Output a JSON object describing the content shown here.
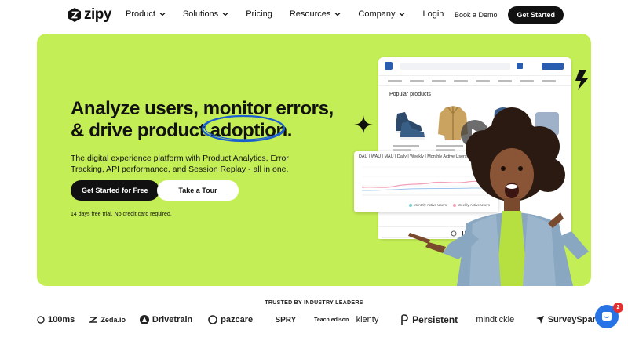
{
  "brand": {
    "name": "zipy"
  },
  "nav": {
    "items": [
      {
        "label": "Product",
        "dropdown": true
      },
      {
        "label": "Solutions",
        "dropdown": true
      },
      {
        "label": "Pricing",
        "dropdown": false
      },
      {
        "label": "Resources",
        "dropdown": true
      },
      {
        "label": "Company",
        "dropdown": true
      },
      {
        "label": "Login",
        "dropdown": false
      }
    ],
    "book_demo": "Book a Demo",
    "get_started": "Get Started"
  },
  "hero": {
    "headline_line1": "Analyze users, monitor errors,",
    "headline_line2_prefix": "& drive product ",
    "headline_highlight": "adoption.",
    "subtext": "The digital experience platform with Product Analytics, Error Tracking, API performance, and Session Replay - all in one.",
    "primary_cta": "Get Started for Free",
    "secondary_cta": "Take a Tour",
    "fine_print": "14 days free trial. No credit card required.",
    "accent_color": "#c4ee55",
    "highlight_ring_color": "#1a5fd0"
  },
  "mock": {
    "popular_products": "Popular products",
    "chart_title": "DAU | WAU | MAU | Daily | Weekly | Monthly Active Users )",
    "legend": [
      "Monthly Active Users",
      "Weekly Active Users"
    ]
  },
  "trusted": {
    "heading": "TRUSTED BY INDUSTRY LEADERS",
    "logos": [
      "100ms",
      "Zeda.io",
      "Drivetrain",
      "pazcare",
      "SPRY",
      "Teach edison",
      "klenty",
      "Persistent",
      "mindtickle",
      "SurveySparr"
    ]
  },
  "chat": {
    "badge_count": "2",
    "color": "#2773e6"
  }
}
